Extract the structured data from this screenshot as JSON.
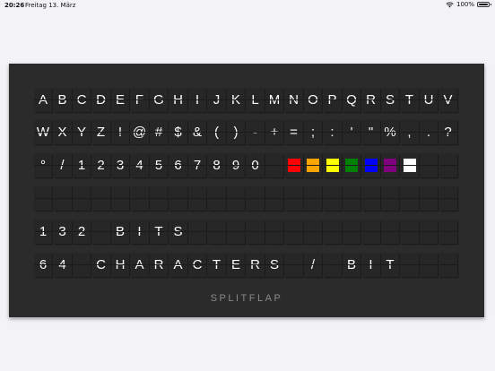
{
  "status_bar": {
    "time": "20:26",
    "date": "Freitag 13. März",
    "battery": "100%",
    "battery_level": 1.0
  },
  "board": {
    "label": "SPLITFLAP",
    "rows": [
      [
        "A",
        "B",
        "C",
        "D",
        "E",
        "F",
        "G",
        "H",
        "I",
        "J",
        "K",
        "L",
        "M",
        "N",
        "O",
        "P",
        "Q",
        "R",
        "S",
        "T",
        "U",
        "V"
      ],
      [
        "W",
        "X",
        "Y",
        "Z",
        "!",
        "@",
        "#",
        "$",
        "&",
        "(",
        ")",
        "-",
        "+",
        "=",
        ";",
        ":",
        "'",
        "\"",
        "%",
        ",",
        ".",
        "?"
      ],
      [
        "°",
        "/",
        "1",
        "2",
        "3",
        "4",
        "5",
        "6",
        "7",
        "8",
        "9",
        "0",
        "",
        "",
        "",
        "",
        "",
        "",
        "",
        "",
        "",
        ""
      ],
      [
        "",
        "",
        "",
        "",
        "",
        "",
        "",
        "",
        "",
        "",
        "",
        "",
        "",
        "",
        "",
        "",
        "",
        "",
        "",
        "",
        "",
        ""
      ],
      [
        "1",
        "3",
        "2",
        "",
        "B",
        "I",
        "T",
        "S",
        "",
        "",
        "",
        "",
        "",
        "",
        "",
        "",
        "",
        "",
        "",
        "",
        "",
        ""
      ],
      [
        "6",
        "4",
        "",
        "C",
        "H",
        "A",
        "R",
        "A",
        "C",
        "T",
        "E",
        "R",
        "S",
        "",
        "/",
        "",
        "B",
        "I",
        "T",
        "",
        "",
        ""
      ]
    ],
    "color_tiles": [
      {
        "row": 2,
        "col": 13,
        "color": "#ff0000"
      },
      {
        "row": 2,
        "col": 14,
        "color": "#ffa500"
      },
      {
        "row": 2,
        "col": 15,
        "color": "#ffff00"
      },
      {
        "row": 2,
        "col": 16,
        "color": "#008000"
      },
      {
        "row": 2,
        "col": 17,
        "color": "#0000ff"
      },
      {
        "row": 2,
        "col": 18,
        "color": "#800080"
      },
      {
        "row": 2,
        "col": 19,
        "color": "#ffffff"
      }
    ]
  },
  "colors": {
    "background": "#f2f2f7",
    "board": "#2b2b2b",
    "tile": "#262626",
    "text": "#ffffff",
    "label": "#8a8a8a"
  }
}
